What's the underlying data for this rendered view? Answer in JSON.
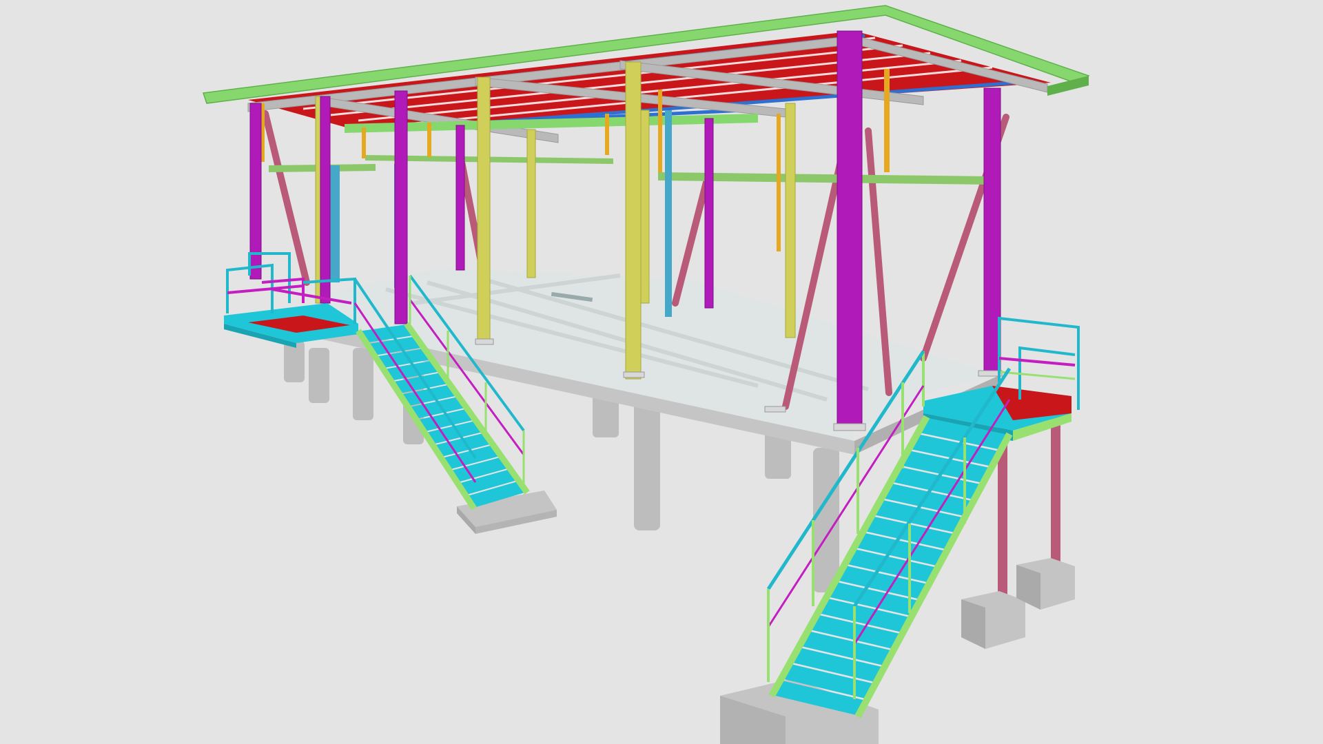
{
  "scene": {
    "background": "#e4e4e4",
    "colors": {
      "roof_edge": "#86d86e",
      "roof_edge_dark": "#5fb04a",
      "roof_deck": "#c8161a",
      "roof_purlin": "#2f6fd0",
      "grey_beam": "#b9b9b9",
      "column_magenta": "#b01ab8",
      "column_yellow": "#cfcf5a",
      "column_blue": "#45a8c8",
      "hanger_orange": "#e6a81f",
      "brace_pink": "#b85a78",
      "beam_green": "#8cc86a",
      "slab_top": "#dfe5e5",
      "slab_side": "#c5c5c5",
      "pile": "#bdbdbd",
      "stair_stringer": "#98e070",
      "stair_tread": "#1ec6d8",
      "rail_cyan": "#22b8cc",
      "rail_magenta": "#c21ec0",
      "landing_red": "#c8161a",
      "footing": "#c4c4c4"
    }
  }
}
